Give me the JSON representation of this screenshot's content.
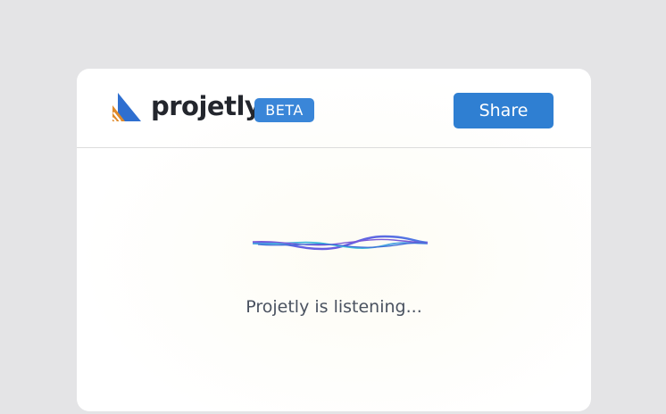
{
  "header": {
    "logo_icon": "projetly-logo-icon",
    "brand_name": "projetly",
    "badge": "BETA",
    "share_label": "Share"
  },
  "main": {
    "waveform_icon": "audio-waveform-icon",
    "status": "Projetly is listening..."
  },
  "colors": {
    "accent": "#2f7fd2",
    "badge": "#3a86d8",
    "logo_blue": "#2f6fd0",
    "logo_orange": "#e08a2a",
    "page_background": "#e4e4e6"
  }
}
